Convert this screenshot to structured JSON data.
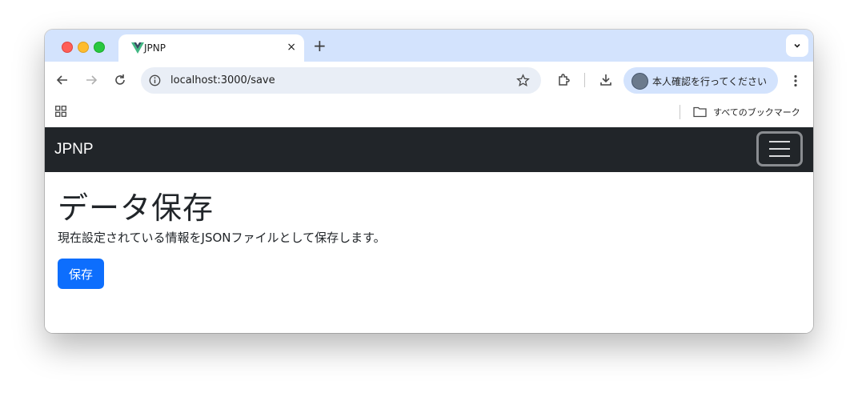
{
  "browser": {
    "tab": {
      "title": "JPNP",
      "close": "×"
    },
    "new_tab": "+",
    "address": {
      "url": "localhost:3000/save"
    },
    "profile": {
      "label": "本人確認を行ってください"
    },
    "bookmarks": {
      "folder_label": "すべてのブックマーク"
    }
  },
  "navbar": {
    "brand": "JPNP"
  },
  "main": {
    "title": "データ保存",
    "description": "現在設定されている情報をJSONファイルとして保存します。",
    "save_button": "保存"
  },
  "colors": {
    "navbar_bg": "#212529",
    "primary": "#0d6efd",
    "tabstrip": "#d3e3fd"
  },
  "icons": [
    "vue-logo-icon",
    "chevron-down-icon",
    "back-arrow-icon",
    "forward-arrow-icon",
    "reload-icon",
    "info-icon",
    "star-icon",
    "extensions-icon",
    "download-icon",
    "more-vert-icon",
    "apps-grid-icon",
    "folder-icon",
    "hamburger-icon"
  ]
}
